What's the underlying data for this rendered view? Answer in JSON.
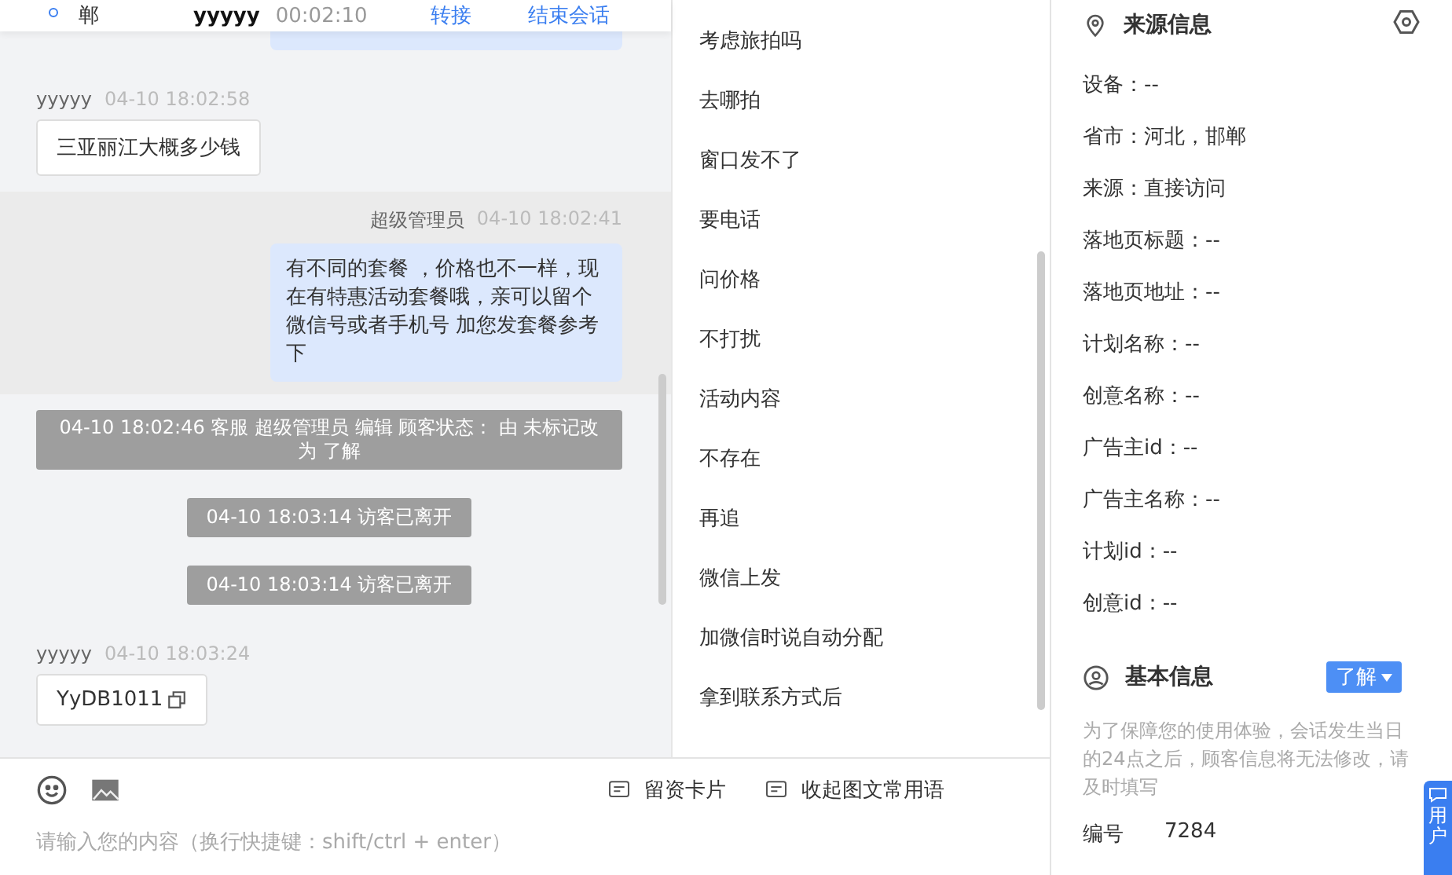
{
  "header": {
    "location": "郸",
    "visitor": "yyyyy",
    "duration": "00:02:10",
    "actions": [
      "转接",
      "结束会话"
    ]
  },
  "messages": [
    {
      "kind": "clipped"
    },
    {
      "kind": "visitor",
      "name": "yyyyy",
      "time": "04-10 18:02:58",
      "text": "三亚丽江大概多少钱"
    },
    {
      "kind": "agent",
      "name": "超级管理员",
      "time": "04-10 18:02:41",
      "text": "有不同的套餐 ，价格也不一样，现在有特惠活动套餐哦，亲可以留个微信号或者手机号 加您发套餐参考下"
    },
    {
      "kind": "system",
      "wide": true,
      "text": "04-10 18:02:46 客服 超级管理员 编辑 顾客状态： 由 未标记改为 了解"
    },
    {
      "kind": "system",
      "wide": false,
      "text": "04-10 18:03:14 访客已离开"
    },
    {
      "kind": "system",
      "wide": false,
      "text": "04-10 18:03:14 访客已离开"
    },
    {
      "kind": "visitor",
      "name": "yyyyy",
      "time": "04-10 18:03:24",
      "text": "YyDB1011",
      "copy": true
    }
  ],
  "quick_replies": [
    "考虑旅拍吗",
    "去哪拍",
    "窗口发不了",
    "要电话",
    "问价格",
    "不打扰",
    "活动内容",
    "不存在",
    "再追",
    "微信上发",
    "加微信时说自动分配",
    "拿到联系方式后"
  ],
  "composer": {
    "placeholder": "请输入您的内容（换行快捷键：shift/ctrl + enter）",
    "actions": [
      "留资卡片",
      "收起图文常用语"
    ]
  },
  "source_info": {
    "title": "来源信息",
    "items": [
      "设备：--",
      "省市：河北，邯郸",
      "来源：直接访问",
      "落地页标题：--",
      "落地页地址：--",
      "计划名称：--",
      "创意名称：--",
      "广告主id：--",
      "广告主名称：--",
      "计划id：--",
      "创意id：--"
    ]
  },
  "basic_info": {
    "title": "基本信息",
    "status": "了解",
    "note": "为了保障您的使用体验，会话发生当日的24点之后，顾客信息将无法修改，请及时填写",
    "fields": [
      {
        "label": "编号",
        "value": "7284"
      }
    ]
  },
  "float_button": {
    "label": "用户"
  }
}
